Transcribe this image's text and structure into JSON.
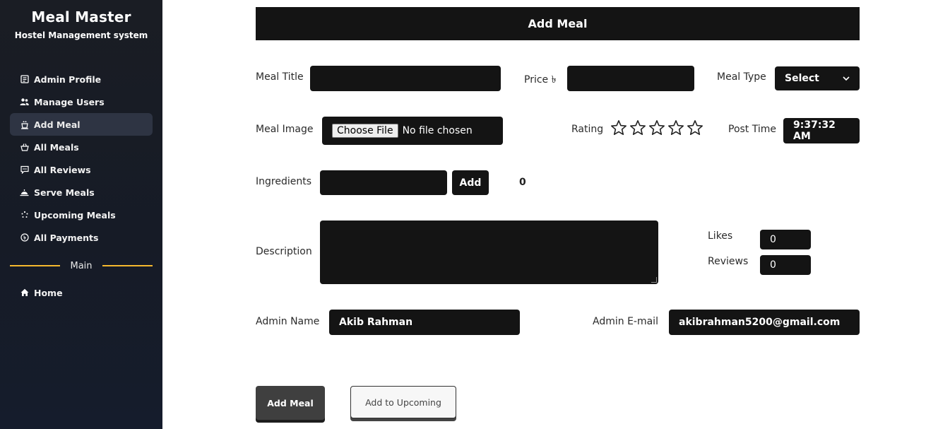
{
  "sidebar": {
    "title": "Meal Master",
    "subtitle": "Hostel Management system",
    "items": [
      {
        "label": "Admin Profile",
        "icon": "profile-icon",
        "active": false
      },
      {
        "label": "Manage Users",
        "icon": "users-icon",
        "active": false
      },
      {
        "label": "Add Meal",
        "icon": "meal-icon",
        "active": true
      },
      {
        "label": "All Meals",
        "icon": "basket-icon",
        "active": false
      },
      {
        "label": "All Reviews",
        "icon": "review-icon",
        "active": false
      },
      {
        "label": "Serve Meals",
        "icon": "serve-icon",
        "active": false
      },
      {
        "label": "Upcoming Meals",
        "icon": "upcoming-icon",
        "active": false
      },
      {
        "label": "All Payments",
        "icon": "payment-icon",
        "active": false
      }
    ],
    "divider_label": "Main",
    "home_label": "Home"
  },
  "form": {
    "header": "Add Meal",
    "meal_title_label": "Meal Title",
    "meal_title_value": "",
    "price_label": "Price ৳",
    "price_value": "",
    "meal_type_label": "Meal Type",
    "meal_type_selected": "Select",
    "meal_image_label": "Meal Image",
    "choose_file_label": "Choose File",
    "file_status": "No file chosen",
    "rating_label": "Rating",
    "rating_value": 0,
    "rating_max": 5,
    "post_time_label": "Post Time",
    "post_time_value": "9:37:32 AM",
    "ingredients_label": "Ingredients",
    "ingredients_value": "",
    "ingredients_add_label": "Add",
    "ingredients_count": "0",
    "description_label": "Description",
    "description_value": "",
    "likes_label": "Likes",
    "likes_value": "0",
    "reviews_label": "Reviews",
    "reviews_value": "0",
    "admin_name_label": "Admin Name",
    "admin_name_value": "Akib Rahman",
    "admin_email_label": "Admin E-mail",
    "admin_email_value": "akibrahman5200@gmail.com"
  },
  "actions": {
    "add_meal_label": "Add Meal",
    "add_upcoming_label": "Add to Upcoming"
  },
  "colors": {
    "sidebar_bg": "#161b26",
    "field_bg": "#141414",
    "divider_accent": "#f5b82e",
    "active_item_bg": "#2e3443"
  }
}
